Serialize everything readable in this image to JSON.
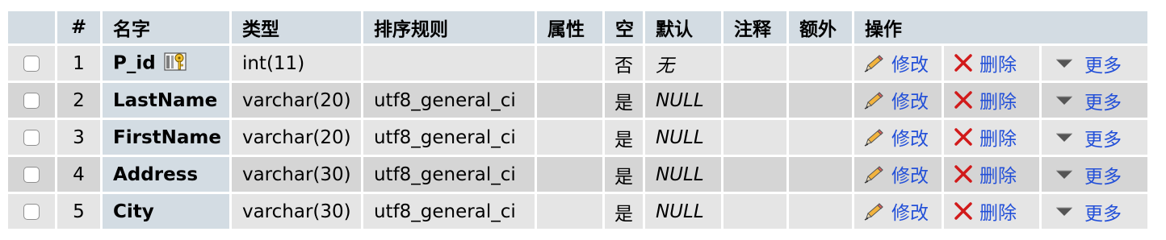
{
  "headers": [
    "",
    "#",
    "名字",
    "类型",
    "排序规则",
    "属性",
    "空",
    "默认",
    "注释",
    "额外",
    "操作"
  ],
  "rows": [
    {
      "num": "1",
      "name": "P_id",
      "type": "int(11)",
      "collation": "",
      "attributes": "",
      "null": "否",
      "default": "无",
      "comment": "",
      "extra": "",
      "primary_key": true
    },
    {
      "num": "2",
      "name": "LastName",
      "type": "varchar(20)",
      "collation": "utf8_general_ci",
      "attributes": "",
      "null": "是",
      "default": "NULL",
      "comment": "",
      "extra": "",
      "primary_key": false
    },
    {
      "num": "3",
      "name": "FirstName",
      "type": "varchar(20)",
      "collation": "utf8_general_ci",
      "attributes": "",
      "null": "是",
      "default": "NULL",
      "comment": "",
      "extra": "",
      "primary_key": false
    },
    {
      "num": "4",
      "name": "Address",
      "type": "varchar(30)",
      "collation": "utf8_general_ci",
      "attributes": "",
      "null": "是",
      "default": "NULL",
      "comment": "",
      "extra": "",
      "primary_key": false
    },
    {
      "num": "5",
      "name": "City",
      "type": "varchar(30)",
      "collation": "utf8_general_ci",
      "attributes": "",
      "null": "是",
      "default": "NULL",
      "comment": "",
      "extra": "",
      "primary_key": false
    }
  ],
  "actions": {
    "edit_label": "修改",
    "delete_label": "删除",
    "more_label": "更多"
  },
  "icons": {
    "edit": "pencil-icon",
    "delete": "delete-x-icon",
    "more": "dropdown-triangle-icon",
    "primary_key": "primary-key-icon"
  },
  "colors": {
    "header_bg": "#d3dce3",
    "row_odd": "#e5e5e5",
    "row_even": "#d5d5d5",
    "link": "#2350d8",
    "delete_x": "#d11a1a"
  }
}
